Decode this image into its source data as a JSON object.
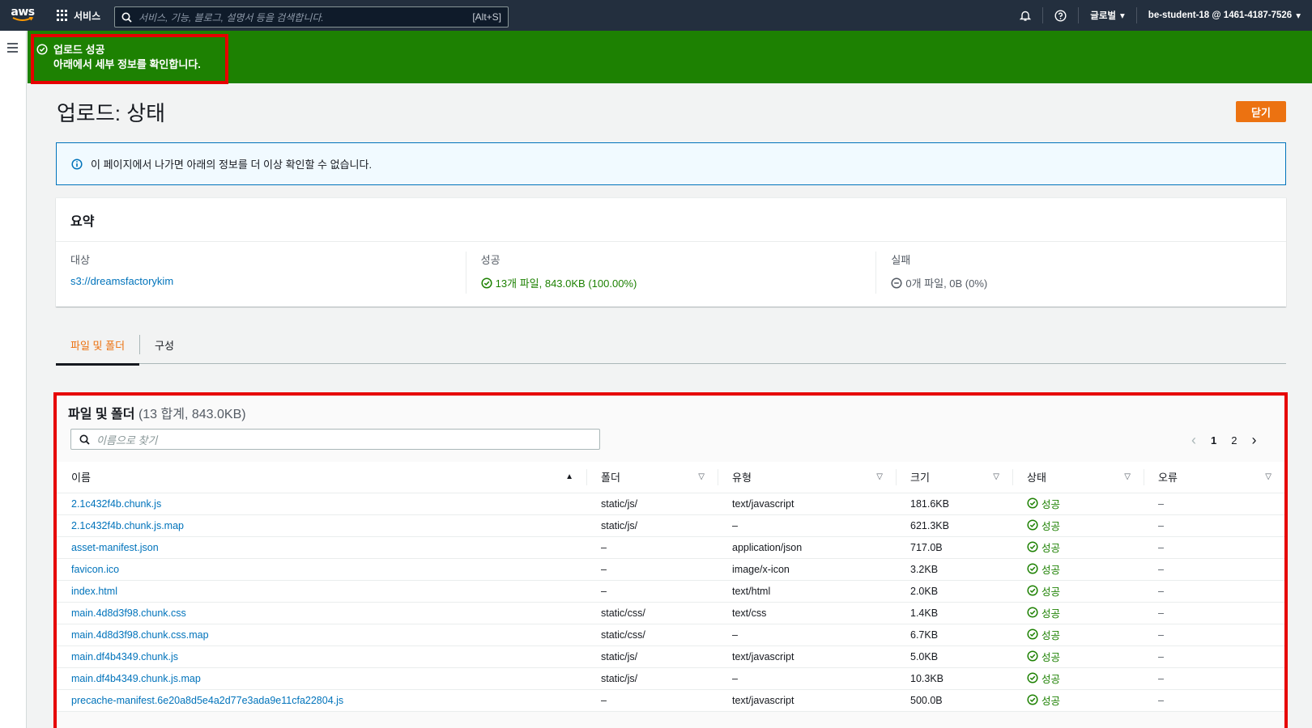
{
  "topnav": {
    "logo": "aws",
    "services_label": "서비스",
    "search_placeholder": "서비스, 기능, 블로그, 설명서 등을 검색합니다.",
    "search_shortcut": "[Alt+S]",
    "region_label": "글로벌",
    "account_label": "be-student-18 @ 1461-4187-7526"
  },
  "flash": {
    "title": "업로드 성공",
    "description": "아래에서 세부 정보를 확인합니다."
  },
  "page": {
    "title": "업로드: 상태",
    "close_label": "닫기",
    "info_text": "이 페이지에서 나가면 아래의 정보를 더 이상 확인할 수 없습니다."
  },
  "summary": {
    "heading": "요약",
    "target_label": "대상",
    "target_value": "s3://dreamsfactorykim",
    "success_label": "성공",
    "success_value": "13개 파일, 843.0KB (100.00%)",
    "failure_label": "실패",
    "failure_value": "0개 파일, 0B (0%)"
  },
  "tabs": [
    {
      "label": "파일 및 폴더"
    },
    {
      "label": "구성"
    }
  ],
  "files": {
    "title": "파일 및 폴더",
    "count": "(13 합계, 843.0KB)",
    "filter_placeholder": "이름으로 찾기",
    "pages": [
      "1",
      "2"
    ],
    "columns": [
      "이름",
      "폴더",
      "유형",
      "크기",
      "상태",
      "오류"
    ],
    "rows": [
      {
        "name": "2.1c432f4b.chunk.js",
        "folder": "static/js/",
        "type": "text/javascript",
        "size": "181.6KB",
        "status": "성공",
        "error": "–"
      },
      {
        "name": "2.1c432f4b.chunk.js.map",
        "folder": "static/js/",
        "type": "–",
        "size": "621.3KB",
        "status": "성공",
        "error": "–"
      },
      {
        "name": "asset-manifest.json",
        "folder": "–",
        "type": "application/json",
        "size": "717.0B",
        "status": "성공",
        "error": "–"
      },
      {
        "name": "favicon.ico",
        "folder": "–",
        "type": "image/x-icon",
        "size": "3.2KB",
        "status": "성공",
        "error": "–"
      },
      {
        "name": "index.html",
        "folder": "–",
        "type": "text/html",
        "size": "2.0KB",
        "status": "성공",
        "error": "–"
      },
      {
        "name": "main.4d8d3f98.chunk.css",
        "folder": "static/css/",
        "type": "text/css",
        "size": "1.4KB",
        "status": "성공",
        "error": "–"
      },
      {
        "name": "main.4d8d3f98.chunk.css.map",
        "folder": "static/css/",
        "type": "–",
        "size": "6.7KB",
        "status": "성공",
        "error": "–"
      },
      {
        "name": "main.df4b4349.chunk.js",
        "folder": "static/js/",
        "type": "text/javascript",
        "size": "5.0KB",
        "status": "성공",
        "error": "–"
      },
      {
        "name": "main.df4b4349.chunk.js.map",
        "folder": "static/js/",
        "type": "–",
        "size": "10.3KB",
        "status": "성공",
        "error": "–"
      },
      {
        "name": "precache-manifest.6e20a8d5e4a2d77e3ada9e11cfa22804.js",
        "folder": "–",
        "type": "text/javascript",
        "size": "500.0B",
        "status": "성공",
        "error": "–"
      }
    ]
  },
  "colors": {
    "nav_bg": "#232f3e",
    "success_green": "#1d8102",
    "accent_orange": "#ec7211",
    "link_blue": "#0073bb",
    "annotation_red": "#e60000"
  },
  "icons": {
    "services": "grid-icon",
    "search": "search-icon",
    "notifications": "bell-icon",
    "help": "help-icon",
    "menu": "hamburger-icon",
    "success": "check-circle-icon",
    "info": "info-icon",
    "failure": "minus-circle-icon"
  }
}
